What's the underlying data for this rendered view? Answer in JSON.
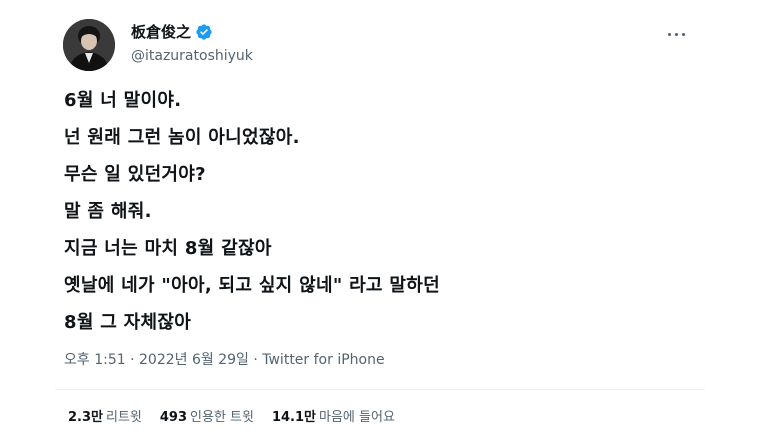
{
  "author": {
    "display_name": "板倉俊之",
    "handle": "@itazuratoshiyuk",
    "verified": true
  },
  "tweet": {
    "lines": [
      "6월 너 말이야.",
      "넌 원래 그런 놈이 아니었잖아.",
      "무슨 일 있던거야?",
      "말 좀 해줘.",
      "지금 너는 마치 8월 같잖아",
      "옛날에 네가 \"아아, 되고 싶지 않네\" 라고 말하던",
      "8월 그 자체잖아"
    ],
    "timestamp": "오후 1:51 · 2022년 6월 29일 · ",
    "source": "Twitter for iPhone"
  },
  "stats": {
    "retweets_count": "2.3만",
    "retweets_label": "리트윗",
    "quotes_count": "493",
    "quotes_label": "인용한 트윗",
    "likes_count": "14.1만",
    "likes_label": "마음에 들어요"
  },
  "colors": {
    "text_primary": "#0f1419",
    "text_secondary": "#536471",
    "verified_blue": "#1d9bf0",
    "divider": "#eff3f4"
  },
  "icons": {
    "verified": "verified-badge-icon",
    "more": "more-dots-icon"
  }
}
